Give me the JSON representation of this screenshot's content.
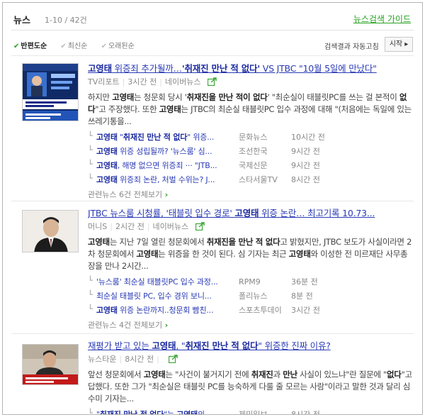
{
  "header": {
    "title": "뉴스",
    "count": "1-10 / 42건",
    "guide_link": "뉴스검색 가이드"
  },
  "sort": {
    "options": [
      "반편도순",
      "최신순",
      "오래된순"
    ],
    "selected": "반편도순",
    "auto_refresh_label": "검색결과 자동고침",
    "start_button": "시작 ▸"
  },
  "results": [
    {
      "title": "고영태 위증죄 추가될까…'취재진 만난 적 없다' VS JTBC \"10월 5일에 만났다\"",
      "title_parts": [
        {
          "t": "고영태",
          "b": true
        },
        {
          "t": " 위증죄 추가될까…",
          "b": false
        },
        {
          "t": "'취재진 만난 적 없다'",
          "b": true
        },
        {
          "t": " VS JTBC \"10월 5일에 만났다\"",
          "b": false
        }
      ],
      "source": "TV리포트",
      "time": "3시간 전",
      "portal": "네이버뉴스",
      "desc_parts": [
        {
          "t": "하지만 ",
          "b": false
        },
        {
          "t": "고영태",
          "b": true
        },
        {
          "t": "는 청문회 당시 '",
          "b": false
        },
        {
          "t": "취재진을 만난 적이 없다",
          "b": true
        },
        {
          "t": "' \"최순실이 태블릿PC를 쓰는 걸 본적이 ",
          "b": false
        },
        {
          "t": "없다",
          "b": true
        },
        {
          "t": "\"고 주장했다. 또한 ",
          "b": false
        },
        {
          "t": "고영태",
          "b": true
        },
        {
          "t": "는 JTBC의 최순실 태블릿PC 입수 과정에 대해 \"(처음에는 독일에 있는 쓰레기통을...",
          "b": false
        }
      ],
      "related": [
        {
          "parts": [
            {
              "t": "고영태",
              "b": true
            },
            {
              "t": " \"",
              "b": false
            },
            {
              "t": "취재진 만난 적 없다",
              "b": true
            },
            {
              "t": "\" 위증...",
              "b": false
            }
          ],
          "source": "문화뉴스",
          "time": "10시간 전"
        },
        {
          "parts": [
            {
              "t": "고영태",
              "b": true
            },
            {
              "t": " 위증 성립될까? '뉴스룸' 심...",
              "b": false
            }
          ],
          "source": "조선한국",
          "time": "9시간 전"
        },
        {
          "parts": [
            {
              "t": "고영태",
              "b": true
            },
            {
              "t": ", 해명 없으면 위증죄 ··· \"JTB...",
              "b": false
            }
          ],
          "source": "국제신문",
          "time": "9시간 전"
        },
        {
          "parts": [
            {
              "t": "고영태",
              "b": true
            },
            {
              "t": " 위증죄 논란, 처벌 수위는? J...",
              "b": false
            }
          ],
          "source": "스타서울TV",
          "time": "8시간 전"
        }
      ],
      "more": "관련뉴스 6건 전체보기"
    },
    {
      "title": "JTBC 뉴스룸 시청률, '태블릿 입수 경로' 고영태 위증 논란… 최고기록 10.73...",
      "title_parts": [
        {
          "t": "JTBC 뉴스룸 시청률, '태블릿 입수 경로' ",
          "b": false
        },
        {
          "t": "고영태",
          "b": true
        },
        {
          "t": " 위증 논란… 최고기록 10.73...",
          "b": false
        }
      ],
      "source": "머니S",
      "time": "2시간 전",
      "portal": "네이버뉴스",
      "desc_parts": [
        {
          "t": "고영태",
          "b": true
        },
        {
          "t": "는 지난 7일 열린 청문회에서 ",
          "b": false
        },
        {
          "t": "취재진을 만난 적 없다",
          "b": true
        },
        {
          "t": "고 밝혔지만, JTBC 보도가 사실이라면 2차 청문회에서 ",
          "b": false
        },
        {
          "t": "고영태",
          "b": true
        },
        {
          "t": "는 위증을 한 것이 된다. 심 기자는 최근 ",
          "b": false
        },
        {
          "t": "고영태",
          "b": true
        },
        {
          "t": "와 이성한 전 미르재단 사무총장을 만나 2시간...",
          "b": false
        }
      ],
      "related": [
        {
          "parts": [
            {
              "t": "'뉴스룸' 최순실 태블릿PC 입수 과정...",
              "b": false
            }
          ],
          "source": "RPM9",
          "time": "36분 전"
        },
        {
          "parts": [
            {
              "t": "최순실 태블릿 PC, 입수 경위 보니...",
              "b": false
            }
          ],
          "source": "폴리뉴스",
          "time": "8분 전"
        },
        {
          "parts": [
            {
              "t": "고영태",
              "b": true
            },
            {
              "t": " 위증 논란까지..청문회 빰친...",
              "b": false
            }
          ],
          "source": "스포츠투데이",
          "time": "3시간 전"
        }
      ],
      "more": "관련뉴스 4건 전체보기"
    },
    {
      "title": "재평가 받고 있는 고영태, \"취재진 만난 적 없다\" 위증한 진짜 이유?",
      "title_parts": [
        {
          "t": "재평가 받고 있는 ",
          "b": false
        },
        {
          "t": "고영태",
          "b": true
        },
        {
          "t": ", \"",
          "b": false
        },
        {
          "t": "취재진 만난 적 없다",
          "b": true
        },
        {
          "t": "\" 위증한 진짜 이유?",
          "b": false
        }
      ],
      "source": "뉴스타운",
      "time": "8시간 전",
      "portal": "",
      "desc_parts": [
        {
          "t": "앞선 청문회에서 ",
          "b": false
        },
        {
          "t": "고영태",
          "b": true
        },
        {
          "t": "는 \"사건이 불거지기 전에 ",
          "b": false
        },
        {
          "t": "취재진",
          "b": true
        },
        {
          "t": "과 ",
          "b": false
        },
        {
          "t": "만난",
          "b": true
        },
        {
          "t": " 사실이 있느냐\"란 질문에 \"",
          "b": false
        },
        {
          "t": "없다",
          "b": true
        },
        {
          "t": "\"고 답했다. 또한 그가 \"최순실은 태블릿 PC를 능숙하게 다룰 줄 모르는 사람\"이라고 말한 것과 달리 심수미 기자는...",
          "b": false
        }
      ],
      "related": [
        {
          "parts": [
            {
              "t": "\"",
              "b": false
            },
            {
              "t": "취재진 만난 적 없다",
              "b": true
            },
            {
              "t": "\"는 ",
              "b": false
            },
            {
              "t": "고영태",
              "b": true
            },
            {
              "t": "의...",
              "b": false
            }
          ],
          "source": "제민일보",
          "time": "8시간 전"
        }
      ],
      "more": ""
    }
  ],
  "icons": {
    "check": "check-icon",
    "share": "share-icon",
    "arrow": "chevron-right-icon"
  },
  "colors": {
    "link": "#2a3bb5",
    "accent": "#26a220",
    "meta": "#888888"
  }
}
